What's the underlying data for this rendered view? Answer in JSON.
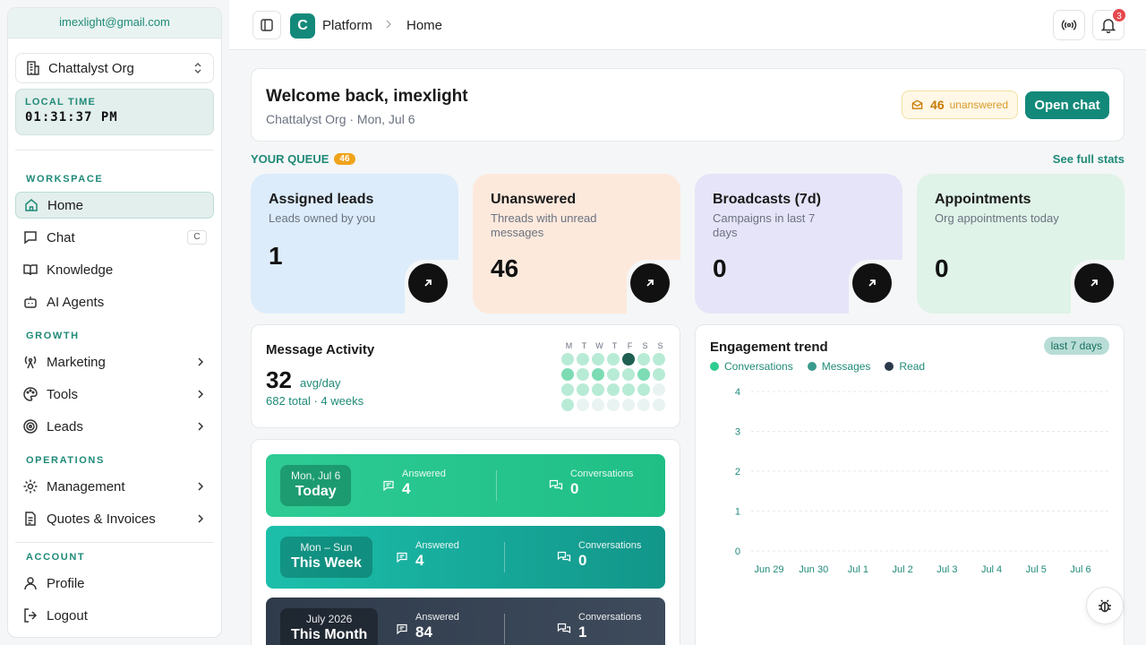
{
  "sidebar": {
    "email": "imexlight@gmail.com",
    "org": "Chattalyst Org",
    "local_time_label": "LOCAL TIME",
    "local_time": "01:31:37 PM",
    "sections": {
      "workspace": "WORKSPACE",
      "growth": "GROWTH",
      "operations": "OPERATIONS",
      "account": "ACCOUNT"
    },
    "items": {
      "home": "Home",
      "chat": "Chat",
      "chat_shortcut": "C",
      "knowledge": "Knowledge",
      "ai_agents": "AI Agents",
      "marketing": "Marketing",
      "tools": "Tools",
      "leads": "Leads",
      "management": "Management",
      "quotes": "Quotes & Invoices",
      "profile": "Profile",
      "logout": "Logout"
    }
  },
  "topbar": {
    "logo_letter": "C",
    "platform": "Platform",
    "page": "Home",
    "notification_count": "3"
  },
  "welcome": {
    "title": "Welcome back, imexlight",
    "subtitle": "Chattalyst Org · Mon, Jul 6",
    "unanswered_count": "46",
    "unanswered_label": "unanswered",
    "open_chat": "Open chat"
  },
  "queue": {
    "title": "YOUR QUEUE",
    "count": "46",
    "see_stats": "See full stats"
  },
  "stats": [
    {
      "title": "Assigned leads",
      "subtitle": "Leads owned by you",
      "value": "1",
      "bg": "#dcecfb"
    },
    {
      "title": "Unanswered",
      "subtitle": "Threads with unread messages",
      "value": "46",
      "bg": "#fde9dc"
    },
    {
      "title": "Broadcasts (7d)",
      "subtitle": "Campaigns in last 7 days",
      "value": "0",
      "bg": "#e6e4f8"
    },
    {
      "title": "Appointments",
      "subtitle": "Org appointments today",
      "value": "0",
      "bg": "#dff3e8"
    }
  ],
  "activity": {
    "title": "Message Activity",
    "value": "32",
    "unit": "avg/day",
    "footer": "682 total · 4 weeks",
    "days": [
      "M",
      "T",
      "W",
      "T",
      "F",
      "S",
      "S"
    ],
    "levels": [
      [
        1,
        1,
        1,
        1,
        4,
        1,
        1
      ],
      [
        2,
        1,
        2,
        1,
        1,
        2,
        1
      ],
      [
        1,
        1,
        1,
        1,
        1,
        1,
        0
      ],
      [
        1,
        0,
        0,
        0,
        0,
        0,
        0
      ]
    ]
  },
  "periods": [
    {
      "date": "Mon, Jul 6",
      "name": "Today",
      "answered_label": "Answered",
      "answered": "4",
      "conv_label": "Conversations",
      "conversations": "0",
      "from": "#2ecb95",
      "to": "#1fbf86"
    },
    {
      "date": "Mon – Sun",
      "name": "This Week",
      "answered_label": "Answered",
      "answered": "4",
      "conv_label": "Conversations",
      "conversations": "0",
      "from": "#1cbfab",
      "to": "#12968a"
    },
    {
      "date": "July 2026",
      "name": "This Month",
      "answered_label": "Answered",
      "answered": "84",
      "conv_label": "Conversations",
      "conversations": "1",
      "from": "#2f3b4b",
      "to": "#3e4b5c"
    }
  ],
  "engagement": {
    "title": "Engagement trend",
    "range": "last 7 days"
  },
  "chart_data": {
    "type": "line",
    "title": "Engagement trend",
    "categories": [
      "Jun 29",
      "Jun 30",
      "Jul 1",
      "Jul 2",
      "Jul 3",
      "Jul 4",
      "Jul 5",
      "Jul 6"
    ],
    "series": [
      {
        "name": "Conversations",
        "color": "#2ecc8f",
        "values": [
          0,
          0,
          0,
          0,
          0,
          0,
          0,
          0
        ]
      },
      {
        "name": "Messages",
        "color": "#3a9b8c",
        "values": [
          0,
          0,
          0,
          0,
          0,
          0,
          0,
          0
        ]
      },
      {
        "name": "Read",
        "color": "#2b3a4a",
        "values": [
          0,
          0,
          0,
          0,
          0,
          0,
          0,
          0
        ]
      }
    ],
    "yticks": [
      "0",
      "1",
      "2",
      "3",
      "4"
    ],
    "ylim": [
      0,
      4
    ],
    "grid": true,
    "legend": "top-left"
  }
}
